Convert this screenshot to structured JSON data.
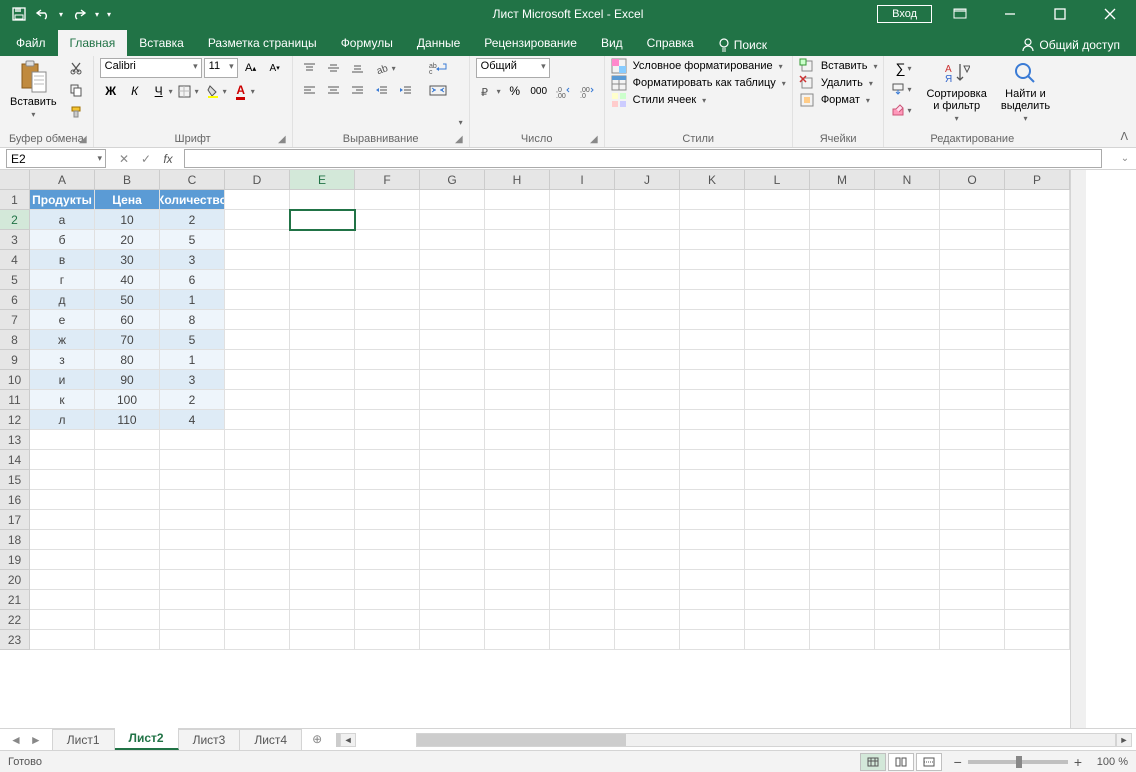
{
  "title": "Лист Microsoft Excel  -  Excel",
  "signin": "Вход",
  "tabs": [
    "Файл",
    "Главная",
    "Вставка",
    "Разметка страницы",
    "Формулы",
    "Данные",
    "Рецензирование",
    "Вид",
    "Справка"
  ],
  "active_tab": 1,
  "search_label": "Поиск",
  "share_label": "Общий доступ",
  "ribbon": {
    "clipboard": {
      "paste": "Вставить",
      "label": "Буфер обмена"
    },
    "font": {
      "name": "Calibri",
      "size": "11",
      "label": "Шрифт",
      "bold": "Ж",
      "italic": "К",
      "underline": "Ч"
    },
    "alignment": {
      "label": "Выравнивание"
    },
    "number": {
      "format": "Общий",
      "label": "Число"
    },
    "styles": {
      "label": "Стили",
      "cond": "Условное форматирование",
      "table": "Форматировать как таблицу",
      "cell": "Стили ячеек"
    },
    "cells": {
      "label": "Ячейки",
      "insert": "Вставить",
      "delete": "Удалить",
      "format": "Формат"
    },
    "editing": {
      "label": "Редактирование",
      "sort": "Сортировка\nи фильтр",
      "find": "Найти и\nвыделить"
    }
  },
  "namebox": "E2",
  "formula": "",
  "columns": [
    "A",
    "B",
    "C",
    "D",
    "E",
    "F",
    "G",
    "H",
    "I",
    "J",
    "K",
    "L",
    "M",
    "N",
    "O",
    "P"
  ],
  "row_count": 23,
  "selected_cell": {
    "col": 4,
    "row": 2
  },
  "table": {
    "headers": [
      "Продукты",
      "Цена",
      "Количество"
    ],
    "rows": [
      [
        "а",
        "10",
        "2"
      ],
      [
        "б",
        "20",
        "5"
      ],
      [
        "в",
        "30",
        "3"
      ],
      [
        "г",
        "40",
        "6"
      ],
      [
        "д",
        "50",
        "1"
      ],
      [
        "е",
        "60",
        "8"
      ],
      [
        "ж",
        "70",
        "5"
      ],
      [
        "з",
        "80",
        "1"
      ],
      [
        "и",
        "90",
        "3"
      ],
      [
        "к",
        "100",
        "2"
      ],
      [
        "л",
        "110",
        "4"
      ]
    ]
  },
  "sheets": [
    "Лист1",
    "Лист2",
    "Лист3",
    "Лист4"
  ],
  "active_sheet": 1,
  "status": "Готово",
  "zoom": "100 %"
}
